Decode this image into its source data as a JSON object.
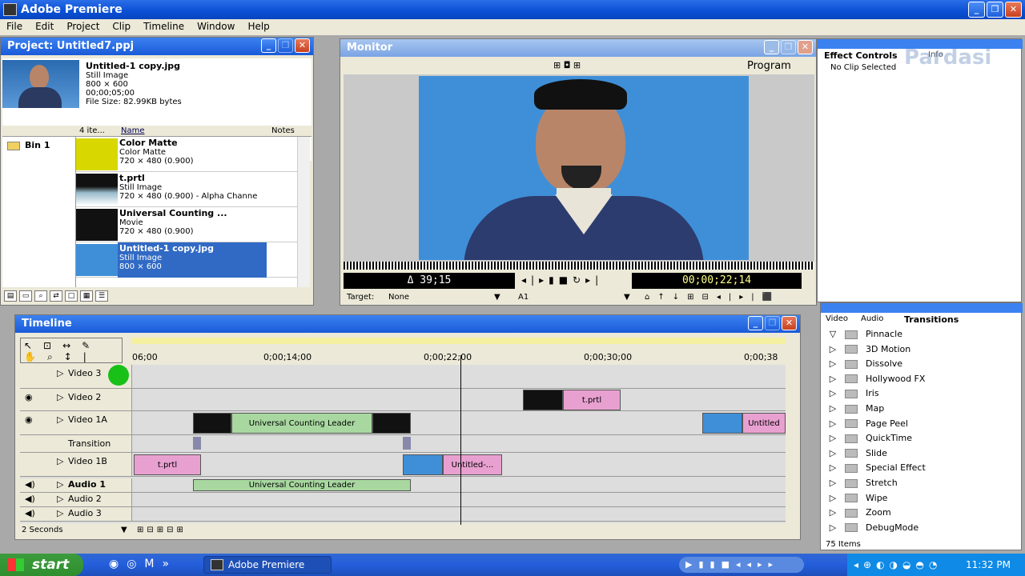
{
  "app": {
    "title": "Adobe Premiere"
  },
  "menu": [
    "File",
    "Edit",
    "Project",
    "Clip",
    "Timeline",
    "Window",
    "Help"
  ],
  "project": {
    "title": "Project: Untitled7.ppj",
    "info": {
      "name": "Untitled-1 copy.jpg",
      "type": "Still Image",
      "dims": "800 × 600",
      "duration": "00;00;05;00",
      "size": "File Size: 82.99KB bytes"
    },
    "count": "4 ite...",
    "col_name": "Name",
    "col_notes": "Notes",
    "bin": "Bin 1",
    "items": [
      {
        "name": "Color Matte",
        "type": "Color Matte",
        "dims": "720 × 480 (0.900)"
      },
      {
        "name": "t.prtl",
        "type": "Still Image",
        "dims": "720 × 480 (0.900) - Alpha Channe"
      },
      {
        "name": "Universal Counting ...",
        "type": "Movie",
        "dims": "720 × 480 (0.900)"
      },
      {
        "name": "Untitled-1 copy.jpg",
        "type": "Still Image",
        "dims": "800 × 600"
      }
    ]
  },
  "monitor": {
    "title": "Monitor",
    "mode": "Program",
    "duration_tc": "Δ 39;15",
    "current_tc": "00;00;22;14",
    "target_label": "Target:",
    "target_value": "None",
    "track_value": "A1"
  },
  "effects": {
    "tab1": "Effect Controls",
    "tab2": "Info",
    "status": "No Clip Selected",
    "watermark": "Pardasi"
  },
  "timeline": {
    "title": "Timeline",
    "ruler": [
      "06;00",
      "0;00;14;00",
      "0;00;22;00",
      "0;00;30;00",
      "0;00;38"
    ],
    "tracks": {
      "v3": "Video 3",
      "v2": "Video 2",
      "v1a": "Video 1A",
      "trans": "Transition",
      "v1b": "Video 1B",
      "a1": "Audio 1",
      "a2": "Audio 2",
      "a3": "Audio 3"
    },
    "clips": {
      "tprtl": "t.prtl",
      "ucl": "Universal Counting Leader",
      "untitled": "Untitled",
      "untitled2": "Untitled-...",
      "aucl": "Universal Counting Leader"
    },
    "zoom": "2 Seconds"
  },
  "transitions": {
    "tabs": [
      "Video",
      "Audio",
      "Transitions"
    ],
    "items": [
      "Pinnacle",
      "3D Motion",
      "Dissolve",
      "Hollywood FX",
      "Iris",
      "Map",
      "Page Peel",
      "QuickTime",
      "Slide",
      "Special Effect",
      "Stretch",
      "Wipe",
      "Zoom",
      "DebugMode"
    ],
    "count": "75 Items"
  },
  "taskbar": {
    "start": "start",
    "task": "Adobe Premiere",
    "clock": "11:32 PM"
  }
}
